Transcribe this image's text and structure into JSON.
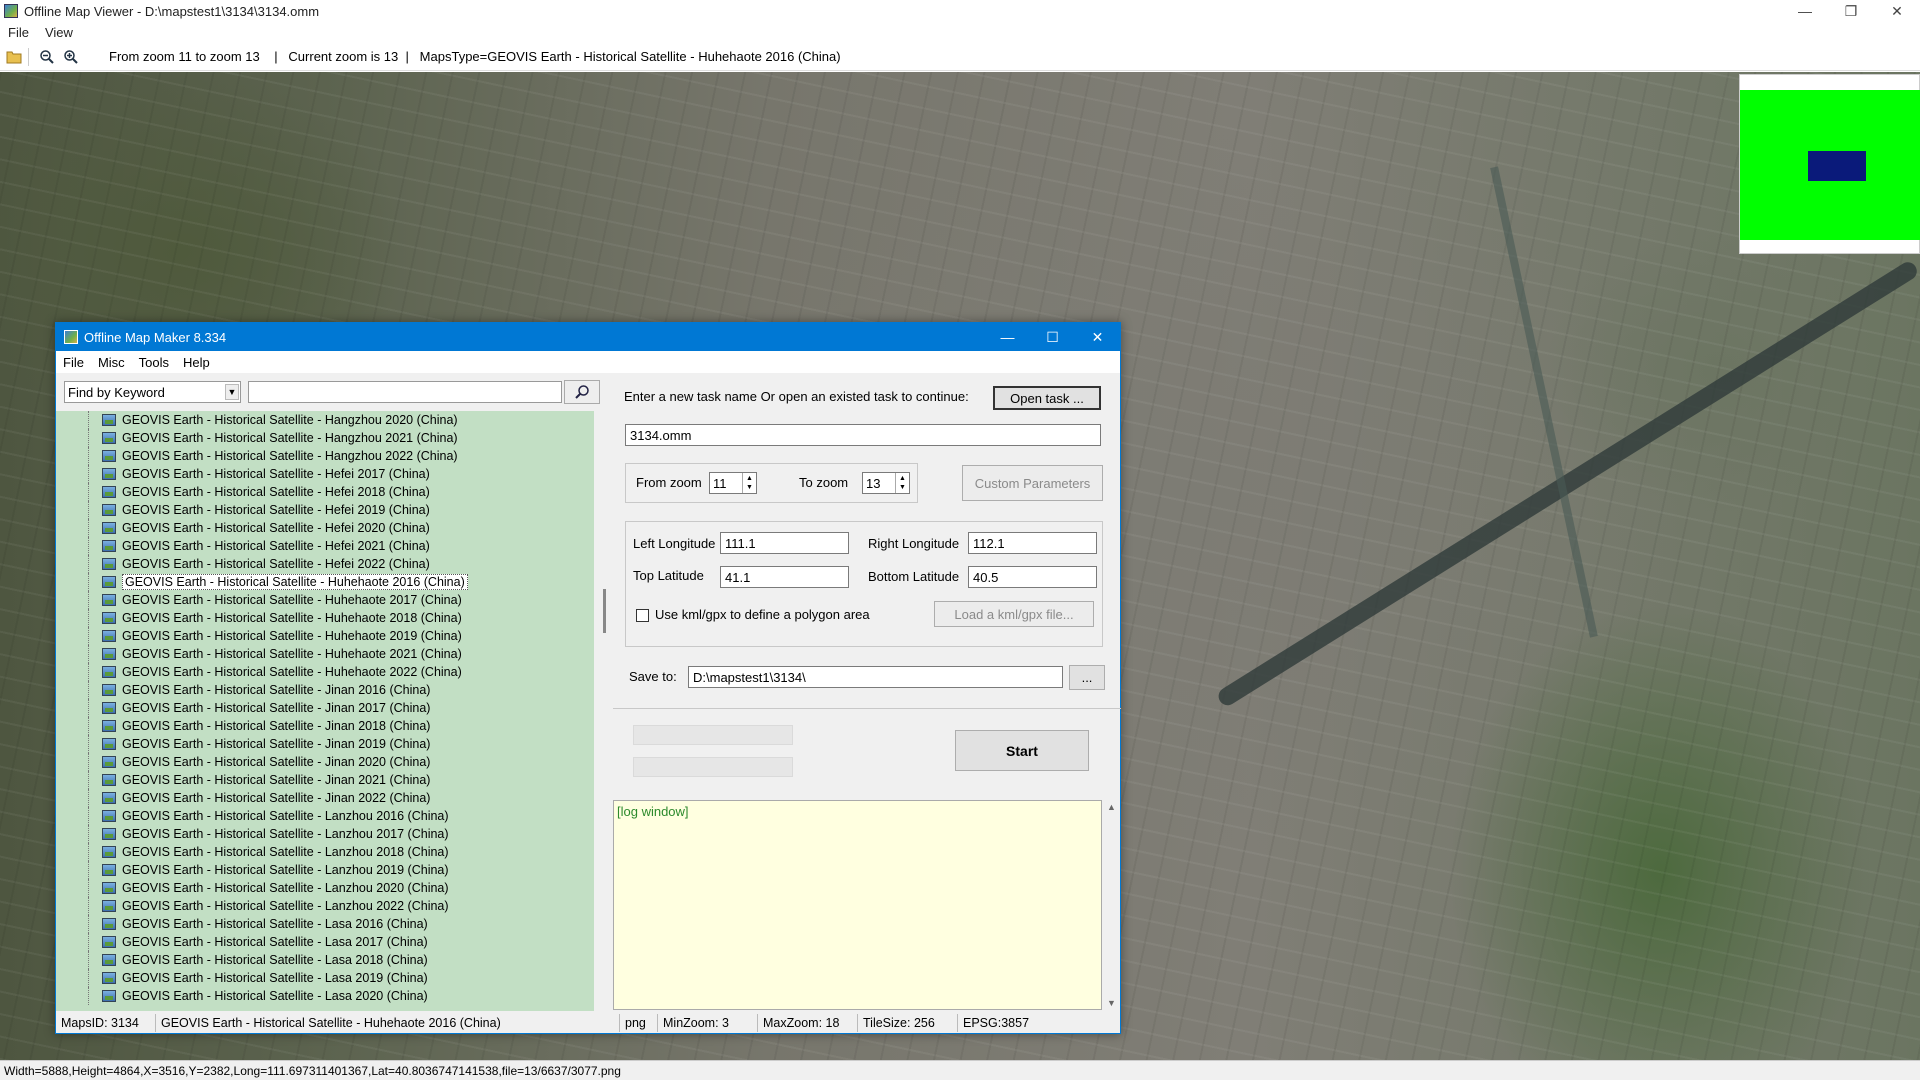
{
  "viewer": {
    "title": "Offline Map Viewer - D:\\mapstest1\\3134\\3134.omm",
    "menu": [
      "File",
      "View"
    ],
    "toolbar_info": "From zoom 11 to zoom 13    |   Current zoom is 13  |   MapsType=GEOVIS Earth - Historical Satellite - Huhehaote 2016 (China)",
    "status": "Width=5888,Height=4864,X=3516,Y=2382,Long=111.697311401367,Lat=40.8036747141538,file=13/6637/3077.png",
    "icons": [
      "folder-open-icon",
      "zoom-out-icon",
      "zoom-in-icon"
    ]
  },
  "dialog": {
    "title": "Offline Map Maker 8.334",
    "menu": [
      "File",
      "Misc",
      "Tools",
      "Help"
    ],
    "search_mode": "Find by Keyword",
    "search_value": "",
    "map_list": [
      "GEOVIS Earth - Historical Satellite - Hangzhou 2020 (China)",
      "GEOVIS Earth - Historical Satellite - Hangzhou 2021 (China)",
      "GEOVIS Earth - Historical Satellite - Hangzhou 2022 (China)",
      "GEOVIS Earth - Historical Satellite - Hefei 2017 (China)",
      "GEOVIS Earth - Historical Satellite - Hefei 2018 (China)",
      "GEOVIS Earth - Historical Satellite - Hefei 2019 (China)",
      "GEOVIS Earth - Historical Satellite - Hefei 2020 (China)",
      "GEOVIS Earth - Historical Satellite - Hefei 2021 (China)",
      "GEOVIS Earth - Historical Satellite - Hefei 2022 (China)",
      "GEOVIS Earth - Historical Satellite - Huhehaote 2016 (China)",
      "GEOVIS Earth - Historical Satellite - Huhehaote 2017 (China)",
      "GEOVIS Earth - Historical Satellite - Huhehaote 2018 (China)",
      "GEOVIS Earth - Historical Satellite - Huhehaote 2019 (China)",
      "GEOVIS Earth - Historical Satellite - Huhehaote 2021 (China)",
      "GEOVIS Earth - Historical Satellite - Huhehaote 2022 (China)",
      "GEOVIS Earth - Historical Satellite - Jinan 2016 (China)",
      "GEOVIS Earth - Historical Satellite - Jinan 2017 (China)",
      "GEOVIS Earth - Historical Satellite - Jinan 2018 (China)",
      "GEOVIS Earth - Historical Satellite - Jinan 2019 (China)",
      "GEOVIS Earth - Historical Satellite - Jinan 2020 (China)",
      "GEOVIS Earth - Historical Satellite - Jinan 2021 (China)",
      "GEOVIS Earth - Historical Satellite - Jinan 2022 (China)",
      "GEOVIS Earth - Historical Satellite - Lanzhou 2016 (China)",
      "GEOVIS Earth - Historical Satellite - Lanzhou 2017 (China)",
      "GEOVIS Earth - Historical Satellite - Lanzhou 2018 (China)",
      "GEOVIS Earth - Historical Satellite - Lanzhou 2019 (China)",
      "GEOVIS Earth - Historical Satellite - Lanzhou 2020 (China)",
      "GEOVIS Earth - Historical Satellite - Lanzhou 2022 (China)",
      "GEOVIS Earth - Historical Satellite - Lasa 2016 (China)",
      "GEOVIS Earth - Historical Satellite - Lasa 2017 (China)",
      "GEOVIS Earth - Historical Satellite - Lasa 2018 (China)",
      "GEOVIS Earth - Historical Satellite - Lasa 2019 (China)",
      "GEOVIS Earth - Historical Satellite - Lasa 2020 (China)"
    ],
    "selected_map": "GEOVIS Earth - Historical Satellite - Huhehaote 2016 (China)",
    "task_prompt": "Enter a new task name Or open an existed task to continue:",
    "open_task_label": "Open task ...",
    "task_name": "3134.omm",
    "from_zoom_label": "From zoom",
    "from_zoom": "11",
    "to_zoom_label": "To zoom",
    "to_zoom": "13",
    "custom_params_label": "Custom Parameters",
    "left_lon_label": "Left Longitude",
    "left_lon": "111.1",
    "right_lon_label": "Right Longitude",
    "right_lon": "112.1",
    "top_lat_label": "Top Latitude",
    "top_lat": "41.1",
    "bottom_lat_label": "Bottom Latitude",
    "bottom_lat": "40.5",
    "kml_label": "Use kml/gpx to define a polygon area",
    "load_kml_label": "Load a kml/gpx file...",
    "save_to_label": "Save to:",
    "save_to": "D:\\mapstest1\\3134\\",
    "browse_label": "...",
    "start_label": "Start",
    "log_text": "[log window]",
    "status": {
      "maps_id": "MapsID: 3134",
      "map_name": "GEOVIS Earth - Historical Satellite - Huhehaote 2016 (China)",
      "format": "png",
      "min_zoom": "MinZoom: 3",
      "max_zoom": "MaxZoom: 18",
      "tile_size": "TileSize: 256",
      "epsg": "EPSG:3857"
    }
  },
  "colors": {
    "accent": "#0078d4",
    "list_bg": "#c2dfc4",
    "log_bg": "#ffffe0",
    "overview_green": "#00ff00",
    "overview_view": "#0a1a7a"
  }
}
